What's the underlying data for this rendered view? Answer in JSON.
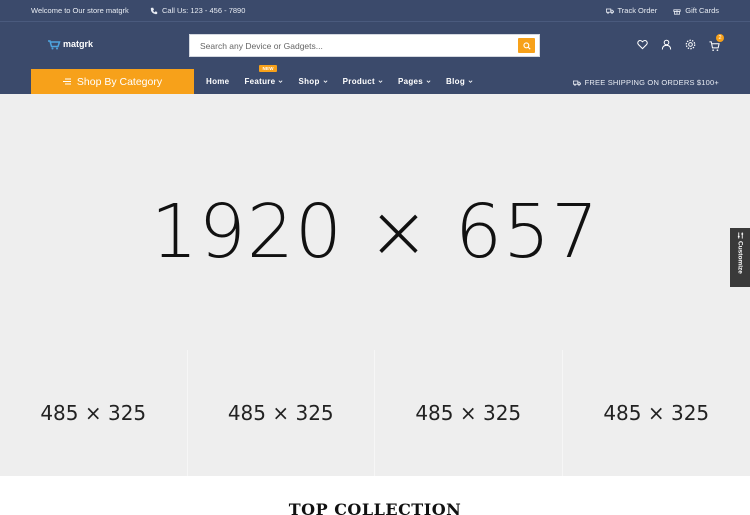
{
  "topbar": {
    "welcome": "Welcome to Our store matgrk",
    "call": "Call Us: 123 - 456 - 7890",
    "track_order": "Track Order",
    "gift_cards": "Gift Cards"
  },
  "header": {
    "logo": "matgrk",
    "search_placeholder": "Search any Device or Gadgets...",
    "cart_count": "2"
  },
  "nav": {
    "category_button": "Shop By Category",
    "items": [
      {
        "label": "Home"
      },
      {
        "label": "Feature",
        "badge": "NEW"
      },
      {
        "label": "Shop"
      },
      {
        "label": "Product"
      },
      {
        "label": "Pages"
      },
      {
        "label": "Blog"
      }
    ],
    "shipping": "FREE SHIPPING ON ORDERS $100+"
  },
  "hero": {
    "placeholder": "1920 × 657"
  },
  "banners": [
    {
      "placeholder": "485 × 325"
    },
    {
      "placeholder": "485 × 325"
    },
    {
      "placeholder": "485 × 325"
    },
    {
      "placeholder": "485 × 325"
    }
  ],
  "section": {
    "title": "TOP COLLECTION"
  },
  "customize": {
    "label": "Customize"
  },
  "colors": {
    "header_bg": "#3b4a6b",
    "accent": "#f7a11a",
    "placeholder_bg": "#eeeeee"
  }
}
